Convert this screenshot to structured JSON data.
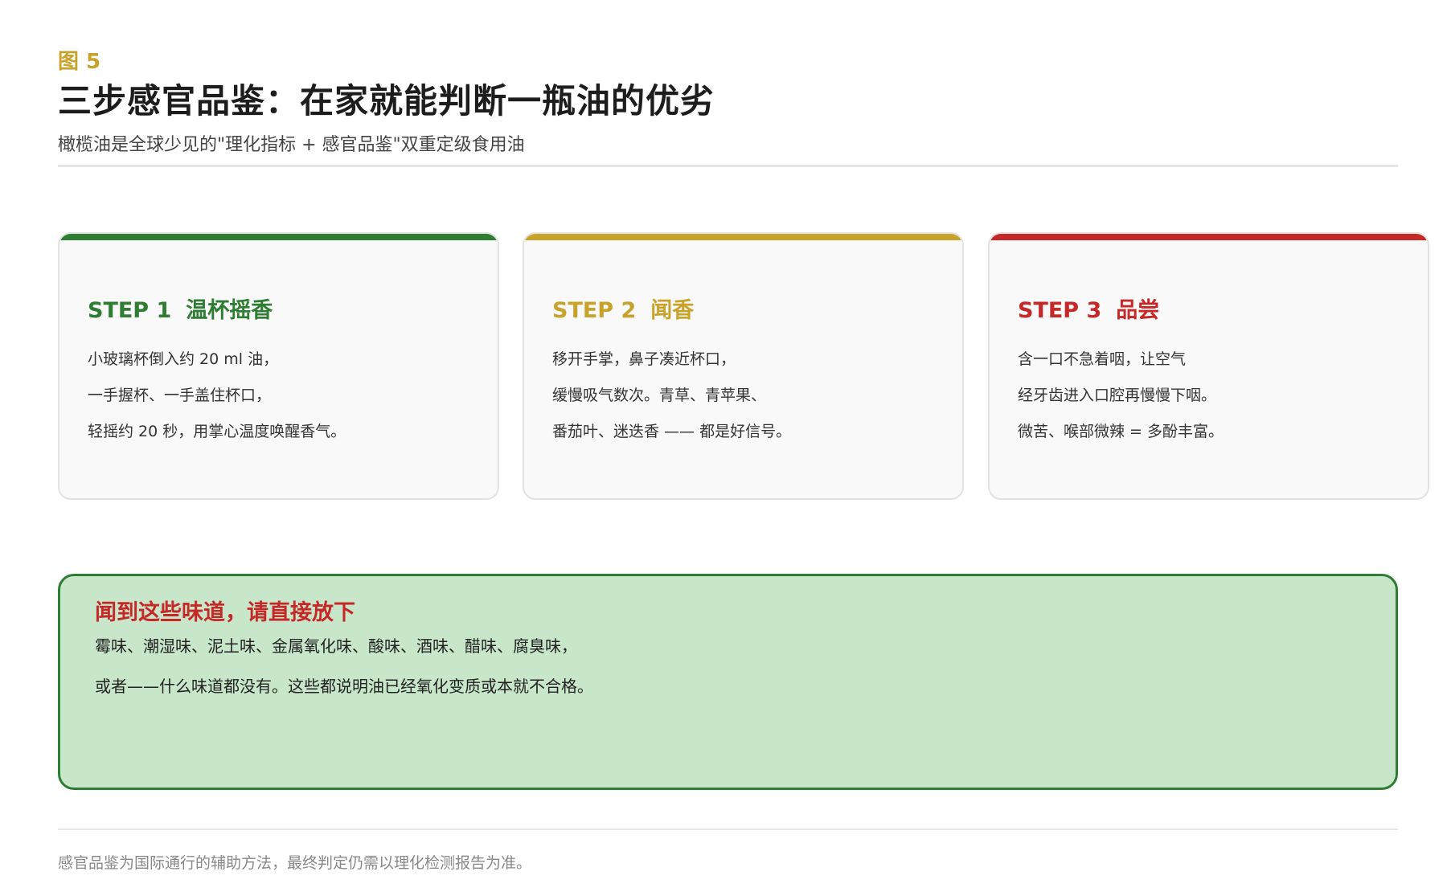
{
  "header": {
    "figure_label": "图 5",
    "title": "三步感官品鉴：在家就能判断一瓶油的优劣",
    "subtitle": "橄榄油是全球少见的\"理化指标 + 感官品鉴\"双重定级食用油"
  },
  "steps": [
    {
      "step_label": "STEP 1",
      "name": "温杯摇香",
      "color": "#2E7D32",
      "lines": [
        "小玻璃杯倒入约 20 ml 油，",
        "一手握杯、一手盖住杯口，",
        "轻摇约 20 秒，用掌心温度唤醒香气。"
      ]
    },
    {
      "step_label": "STEP 2",
      "name": "闻香",
      "color": "#C9A22A",
      "lines": [
        "移开手掌，鼻子凑近杯口，",
        "缓慢吸气数次。青草、青苹果、",
        "番茄叶、迷迭香 —— 都是好信号。"
      ]
    },
    {
      "step_label": "STEP 3",
      "name": "品尝",
      "color": "#C62828",
      "lines": [
        "含一口不急着咽，让空气",
        "经牙齿进入口腔再慢慢下咽。",
        "微苦、喉部微辣 = 多酚丰富。"
      ]
    }
  ],
  "warning": {
    "title": "闻到这些味道，请直接放下",
    "lines": [
      "霉味、潮湿味、泥土味、金属氧化味、酸味、酒味、醋味、腐臭味，",
      "或者——什么味道都没有。这些都说明油已经氧化变质或本就不合格。"
    ],
    "background": "#C8E6C9",
    "border_color": "#2E7D32",
    "title_color": "#C62828"
  },
  "footer": {
    "note": "感官品鉴为国际通行的辅助方法，最终判定仍需以理化检测报告为准。"
  }
}
